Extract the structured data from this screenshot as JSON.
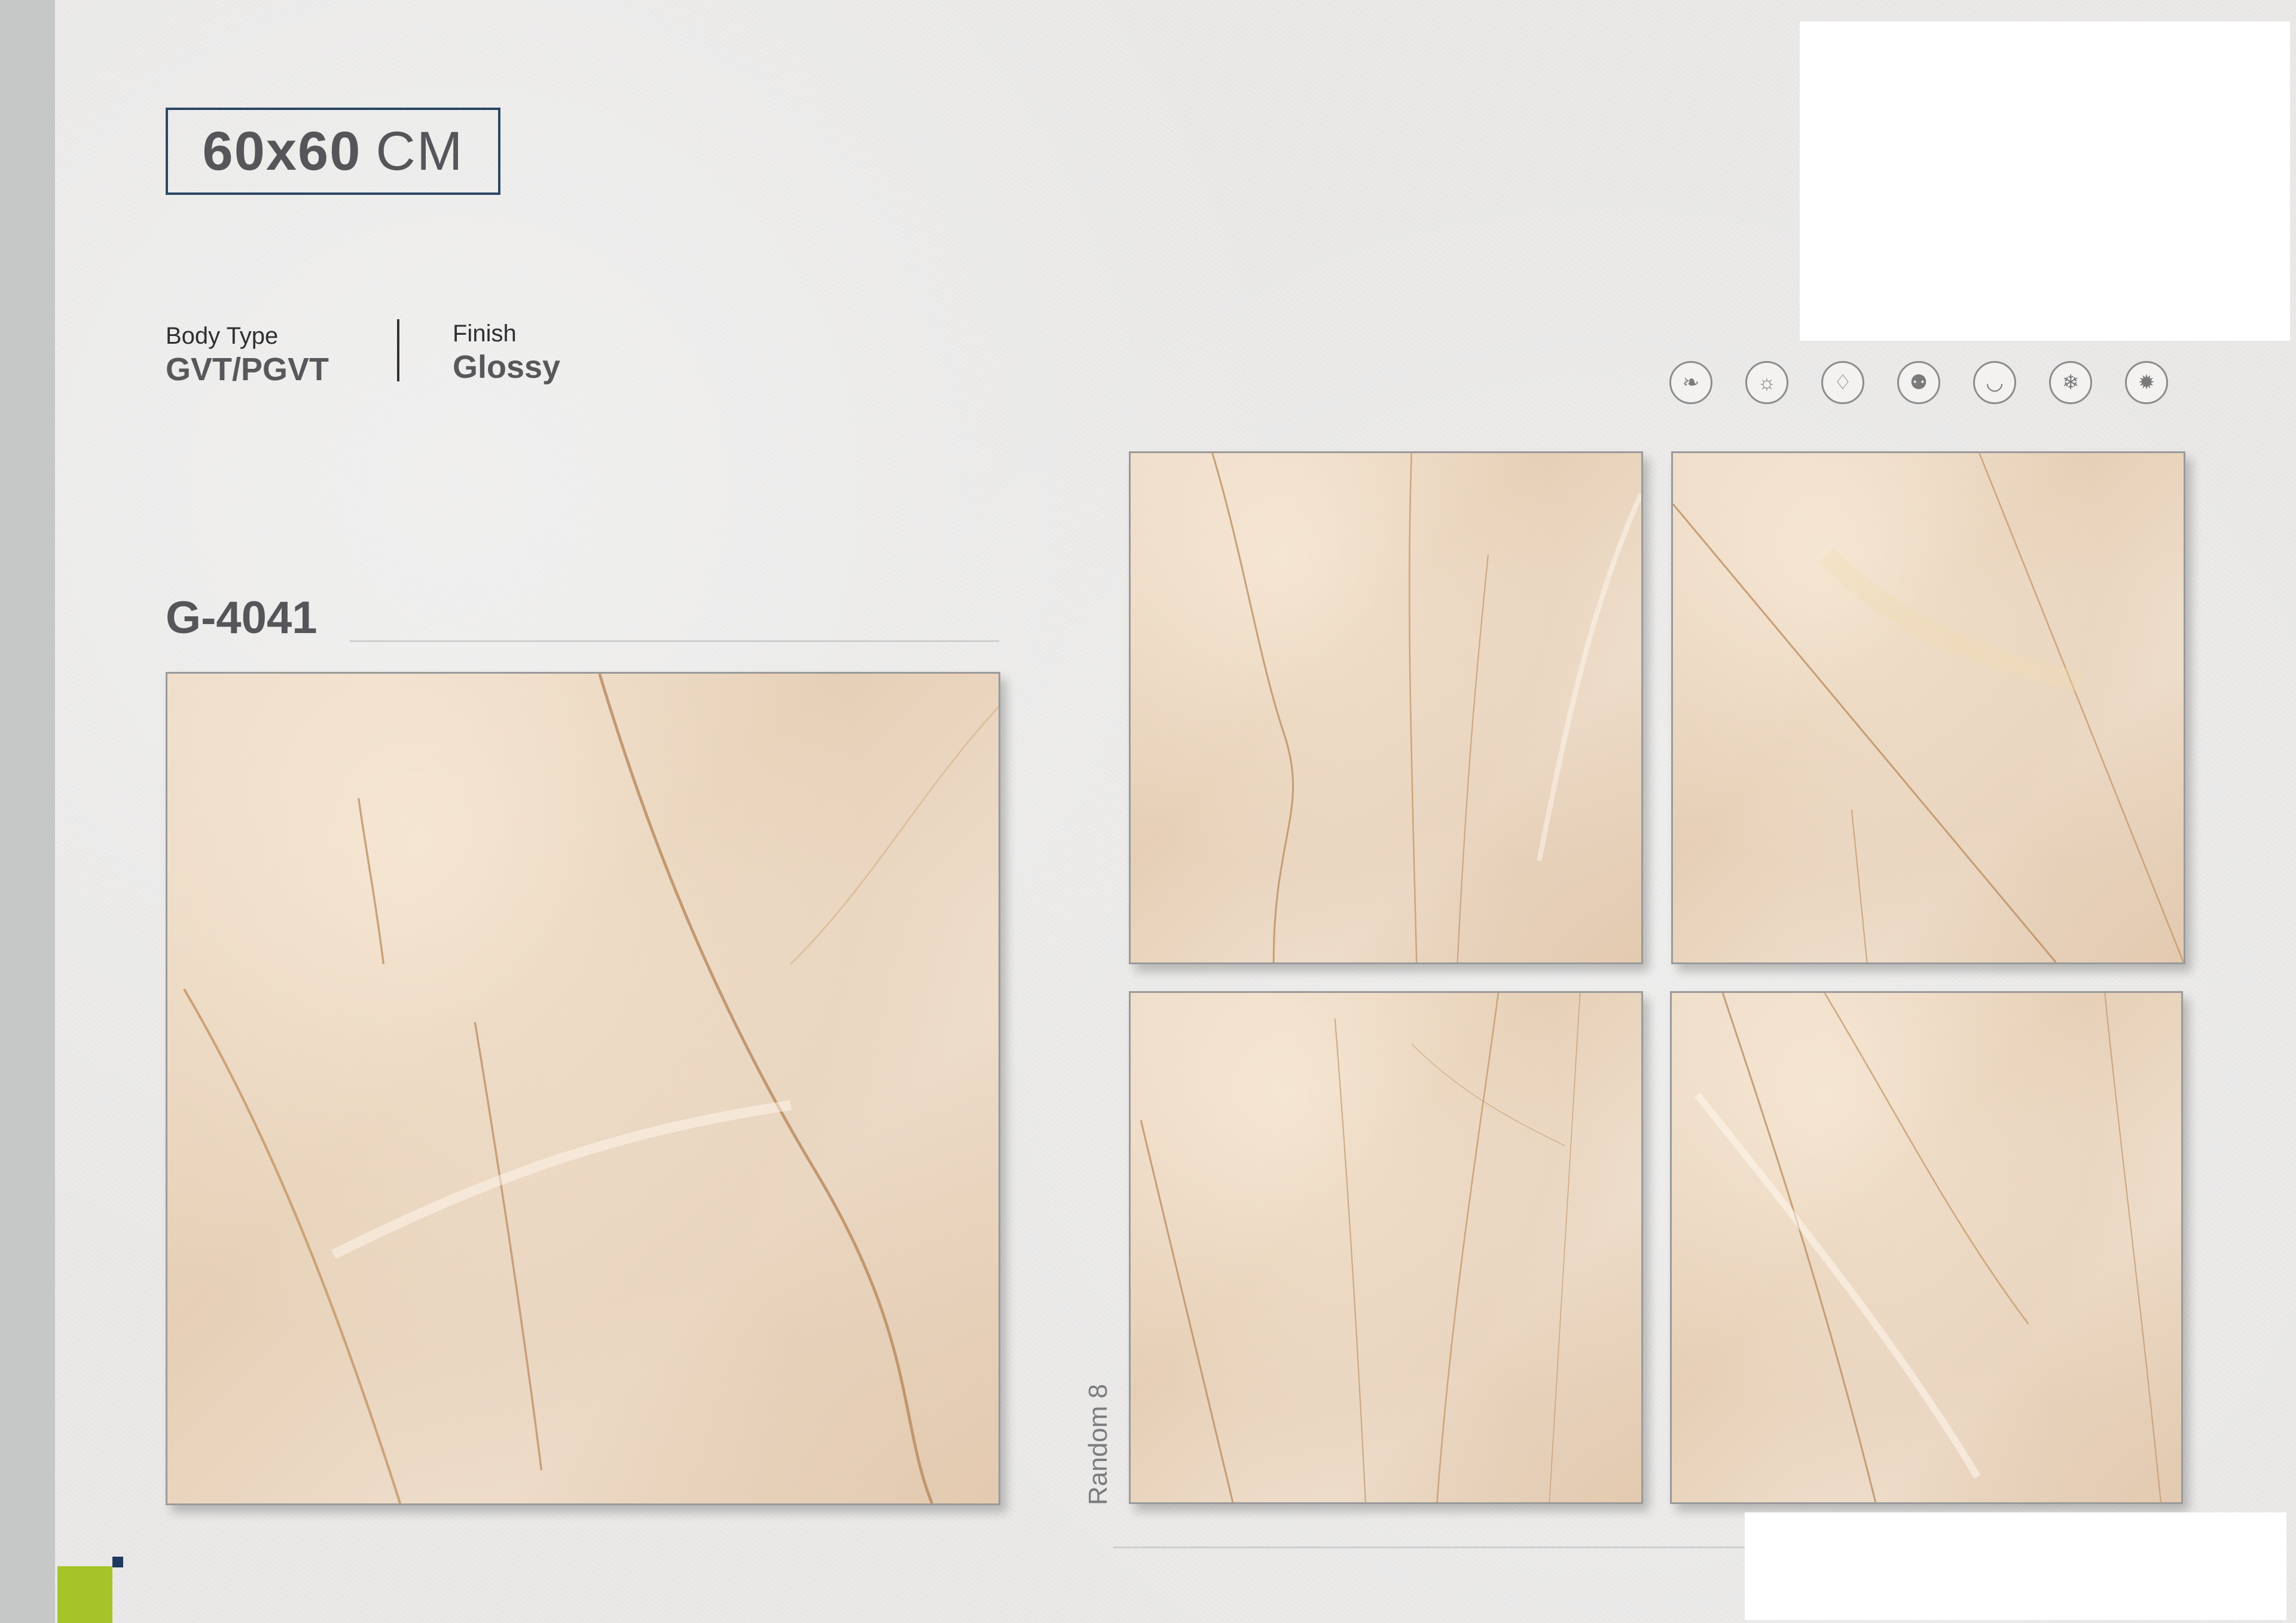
{
  "size": {
    "value": "60x60",
    "unit": "CM"
  },
  "specs": {
    "body_type_label": "Body Type",
    "body_type_value": "GVT/PGVT",
    "finish_label": "Finish",
    "finish_value": "Glossy"
  },
  "product_code": "G-4041",
  "random_label": "Random 8",
  "icons": [
    "leaf-icon",
    "sun-icon",
    "water-drop-icon",
    "people-icon",
    "bathtub-icon",
    "snowflake-icon",
    "gear-icon"
  ],
  "colors": {
    "accent_navy": "#2c4763",
    "accent_green": "#a4c42a",
    "tile_base": "#e8d4bd",
    "vein": "#b8885a"
  }
}
